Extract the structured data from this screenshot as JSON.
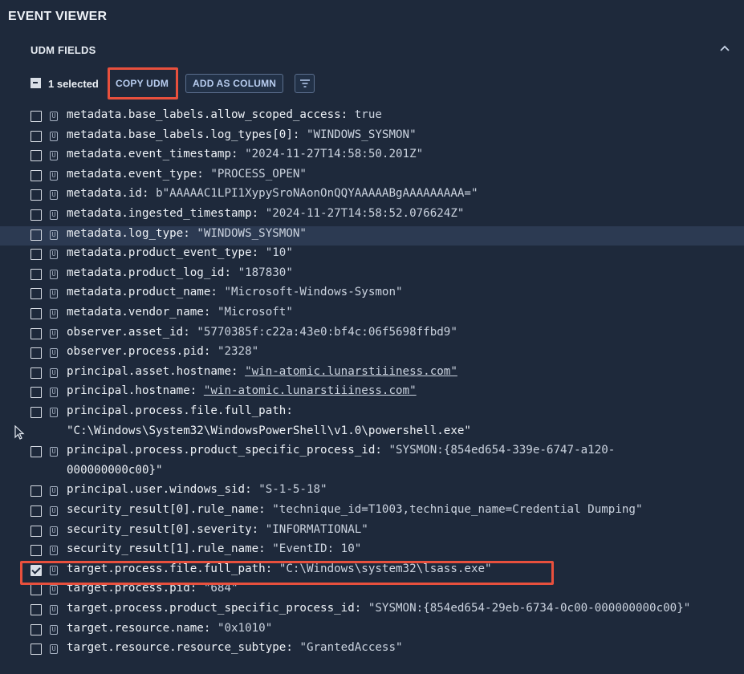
{
  "app": {
    "title": "EVENT VIEWER"
  },
  "section": {
    "title": "UDM FIELDS",
    "collapse_icon": "chevron-up-icon"
  },
  "toolbar": {
    "selected_text": "1 selected",
    "copy_label": "COPY UDM",
    "add_column_label": "ADD AS COLUMN",
    "filter_icon": "filter-icon"
  },
  "colors": {
    "accent": "#b8cdf0",
    "highlight_box": "#e8503d",
    "background": "#1e293b",
    "hover_row": "#2c3a52"
  },
  "fields": [
    {
      "key": "metadata.base_labels.allow_scoped_access",
      "value": "true",
      "checked": false
    },
    {
      "key": "metadata.base_labels.log_types[0]",
      "value": "\"WINDOWS_SYSMON\"",
      "checked": false
    },
    {
      "key": "metadata.event_timestamp",
      "value": "\"2024-11-27T14:58:50.201Z\"",
      "checked": false
    },
    {
      "key": "metadata.event_type",
      "value": "\"PROCESS_OPEN\"",
      "checked": false
    },
    {
      "key": "metadata.id",
      "value": "b\"AAAAAC1LPI1XypySroNAonOnQQYAAAAABgAAAAAAAAA=\"",
      "checked": false
    },
    {
      "key": "metadata.ingested_timestamp",
      "value": "\"2024-11-27T14:58:52.076624Z\"",
      "checked": false
    },
    {
      "key": "metadata.log_type",
      "value": "\"WINDOWS_SYSMON\"",
      "checked": false,
      "hover": true
    },
    {
      "key": "metadata.product_event_type",
      "value": "\"10\"",
      "checked": false
    },
    {
      "key": "metadata.product_log_id",
      "value": "\"187830\"",
      "checked": false
    },
    {
      "key": "metadata.product_name",
      "value": "\"Microsoft-Windows-Sysmon\"",
      "checked": false
    },
    {
      "key": "metadata.vendor_name",
      "value": "\"Microsoft\"",
      "checked": false
    },
    {
      "key": "observer.asset_id",
      "value": "\"5770385f:c22a:43e0:bf4c:06f5698ffbd9\"",
      "checked": false
    },
    {
      "key": "observer.process.pid",
      "value": "\"2328\"",
      "checked": false
    },
    {
      "key": "principal.asset.hostname",
      "value": "\"win-atomic.lunarstiiiness.com\"",
      "checked": false,
      "link": true
    },
    {
      "key": "principal.hostname",
      "value": "\"win-atomic.lunarstiiiness.com\"",
      "checked": false,
      "link": true
    },
    {
      "key": "principal.process.file.full_path",
      "value": "",
      "value_line2": "\"C:\\Windows\\System32\\WindowsPowerShell\\v1.0\\powershell.exe\"",
      "checked": false
    },
    {
      "key": "principal.process.product_specific_process_id",
      "value": "\"SYSMON:{854ed654-339e-6747-a120-",
      "value_line2": "000000000c00}\"",
      "checked": false
    },
    {
      "key": "principal.user.windows_sid",
      "value": "\"S-1-5-18\"",
      "checked": false
    },
    {
      "key": "security_result[0].rule_name",
      "value": "\"technique_id=T1003,technique_name=Credential Dumping\"",
      "checked": false
    },
    {
      "key": "security_result[0].severity",
      "value": "\"INFORMATIONAL\"",
      "checked": false
    },
    {
      "key": "security_result[1].rule_name",
      "value": "\"EventID: 10\"",
      "checked": false
    },
    {
      "key": "target.process.file.full_path",
      "value": "\"C:\\Windows\\system32\\lsass.exe\"",
      "checked": true
    },
    {
      "key": "target.process.pid",
      "value": "\"684\"",
      "checked": false
    },
    {
      "key": "target.process.product_specific_process_id",
      "value": "\"SYSMON:{854ed654-29eb-6734-0c00-000000000c00}\"",
      "checked": false
    },
    {
      "key": "target.resource.name",
      "value": "\"0x1010\"",
      "checked": false
    },
    {
      "key": "target.resource.resource_subtype",
      "value": "\"GrantedAccess\"",
      "checked": false
    }
  ]
}
